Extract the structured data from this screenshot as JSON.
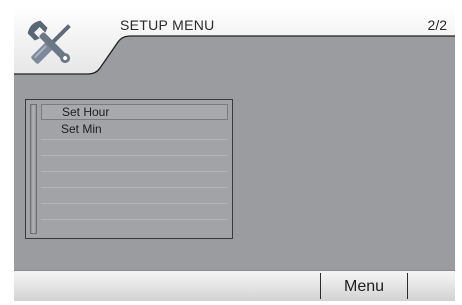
{
  "header": {
    "title": "SETUP MENU",
    "page_indicator": "2/2",
    "icon": "tools-icon"
  },
  "menu": {
    "items": [
      {
        "label": "Set Hour",
        "selected": true
      },
      {
        "label": "Set Min",
        "selected": false
      },
      {
        "label": "",
        "selected": false
      },
      {
        "label": "",
        "selected": false
      },
      {
        "label": "",
        "selected": false
      },
      {
        "label": "",
        "selected": false
      },
      {
        "label": "",
        "selected": false
      },
      {
        "label": "",
        "selected": false
      }
    ]
  },
  "footer": {
    "menu_label": "Menu"
  },
  "colors": {
    "screen_bg": "#9b9c9f",
    "header_tab": "#f0f0f0",
    "footer_bar": "#e3e3e3"
  }
}
